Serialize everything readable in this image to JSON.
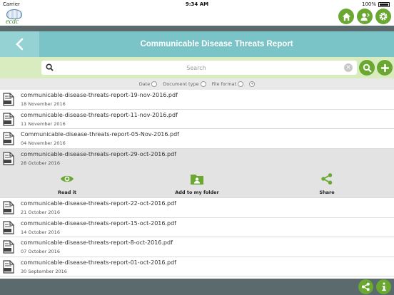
{
  "status_bar": {
    "carrier": "Carrier",
    "time": "9:34 AM",
    "battery": "100%"
  },
  "logo_text": "ecdc",
  "title": "Communicable Disease Threats Report",
  "search": {
    "placeholder": "Search",
    "value": ""
  },
  "sort": {
    "options": [
      {
        "label": "Date"
      },
      {
        "label": "Document type"
      },
      {
        "label": "File format"
      }
    ]
  },
  "documents": [
    {
      "name": "communicable-disease-threats-report-19-nov-2016.pdf",
      "date": "18 November 2016"
    },
    {
      "name": "communicable-disease-threats-report-11-nov-2016.pdf",
      "date": "11 November 2016"
    },
    {
      "name": "Communicable-disease-threats-report-05-Nov-2016.pdf",
      "date": "04 November 2016"
    },
    {
      "name": "communicable-disease-threats-report-29-oct-2016.pdf",
      "date": "28 October 2016"
    },
    {
      "name": "communicable-disease-threats-report-22-oct-2016.pdf",
      "date": "21 October 2016"
    },
    {
      "name": "communicable-disease-threats-report-15-oct-2016.pdf",
      "date": "14 October 2016"
    },
    {
      "name": "communicable-disease-threats-report-8-oct-2016.pdf",
      "date": "07 October 2016"
    },
    {
      "name": "communicable-disease-threats-report-01-oct-2016.pdf",
      "date": "30 September 2016"
    }
  ],
  "actions": {
    "read": "Read it",
    "add": "Add to my folder",
    "share": "Share"
  },
  "colors": {
    "accent_green": "#6aa832",
    "title_teal": "#7ac3c6",
    "search_bg": "#d9ecbf",
    "dark_bar": "#5b6b6d"
  },
  "icons": {
    "top": [
      "home-icon",
      "user-icon",
      "gear-icon"
    ],
    "bottom": [
      "share-icon",
      "info-icon"
    ]
  }
}
